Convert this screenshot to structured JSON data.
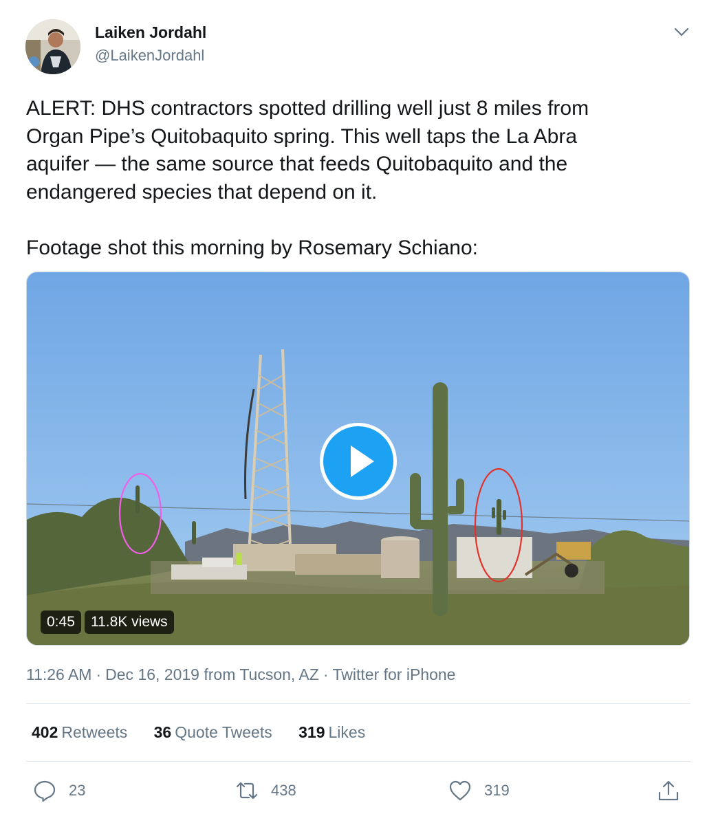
{
  "author": {
    "name": "Laiken Jordahl",
    "handle": "@LaikenJordahl"
  },
  "tweet": {
    "paragraphs": [
      "ALERT: DHS contractors spotted drilling well just 8 miles from\nOrgan Pipe’s Quitobaquito spring. This well taps the La Abra\naquifer — the same source that feeds Quitobaquito and the\nendangered species that depend on it.",
      "Footage shot this morning by Rosemary Schiano:"
    ]
  },
  "video": {
    "duration": "0:45",
    "views": "11.8K views"
  },
  "meta": {
    "time": "11:26 AM",
    "date": "Dec 16, 2019",
    "location": "from Tucson, AZ",
    "source": "Twitter for iPhone",
    "separator": "·"
  },
  "stats": {
    "retweets": {
      "count": "402",
      "label": "Retweets"
    },
    "quotes": {
      "count": "36",
      "label": "Quote Tweets"
    },
    "likes": {
      "count": "319",
      "label": "Likes"
    }
  },
  "actions": {
    "reply_count": "23",
    "retweet_count": "438",
    "like_count": "319"
  },
  "icons": [
    "chevron-down-icon",
    "play-icon",
    "reply-icon",
    "retweet-icon",
    "like-icon",
    "share-icon"
  ],
  "colors": {
    "accent": "#1da1f2",
    "text": "#14171a",
    "secondary": "#657786",
    "divider": "#e1e8ed"
  }
}
